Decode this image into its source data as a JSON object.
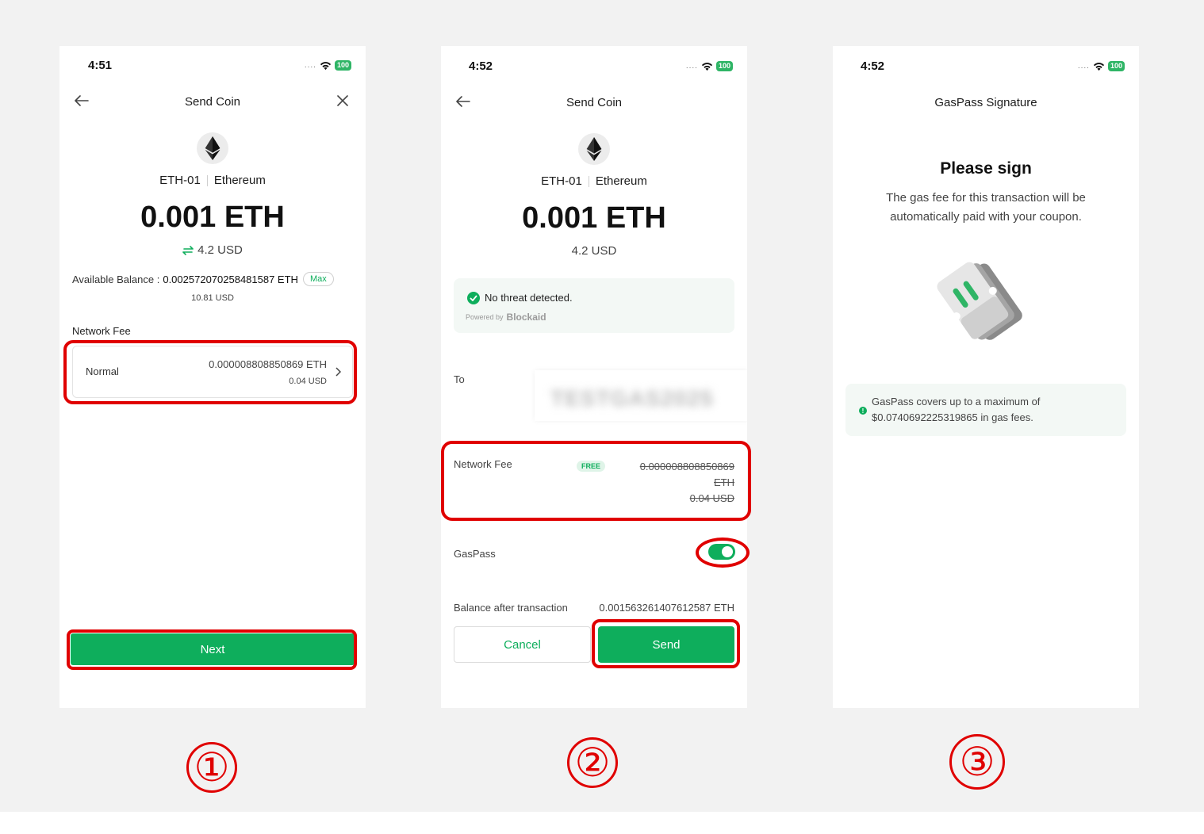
{
  "screen1": {
    "time": "4:51",
    "battery": "100",
    "title": "Send Coin",
    "coin_account": "ETH-01",
    "coin_name": "Ethereum",
    "amount": "0.001 ETH",
    "fiat": "4.2 USD",
    "balance_label": "Available Balance :",
    "balance_value": "0.002572070258481587 ETH",
    "max_label": "Max",
    "balance_fiat": "10.81 USD",
    "fee_section_label": "Network Fee",
    "fee_speed": "Normal",
    "fee_eth": "0.000008808850869 ETH",
    "fee_usd": "0.04 USD",
    "next_label": "Next"
  },
  "screen2": {
    "time": "4:52",
    "battery": "100",
    "title": "Send Coin",
    "coin_account": "ETH-01",
    "coin_name": "Ethereum",
    "amount": "0.001 ETH",
    "fiat": "4.2 USD",
    "threat_text": "No threat detected.",
    "powered_by": "Powered by",
    "powered_brand": "Blockaid",
    "to_label": "To",
    "to_value": "TESTGAS2025",
    "fee_label": "Network Fee",
    "free_badge": "FREE",
    "fee_eth_line1": "0.000008808850869",
    "fee_eth_line2": "ETH",
    "fee_usd": "0.04 USD",
    "gaspass_label": "GasPass",
    "gaspass_enabled": true,
    "balance_after_label": "Balance after transaction",
    "balance_after_value": "0.001563261407612587 ETH",
    "cancel_label": "Cancel",
    "send_label": "Send"
  },
  "screen3": {
    "time": "4:52",
    "battery": "100",
    "title": "GasPass Signature",
    "heading": "Please sign",
    "description_line1": "The gas fee for this transaction will be",
    "description_line2": "automatically paid with your coupon.",
    "info_line1": "GasPass covers up to a maximum of",
    "info_line2": "$0.0740692225319865 in gas fees."
  },
  "steps": [
    "①",
    "②",
    "③"
  ],
  "colors": {
    "accent_green": "#0eae5c",
    "highlight_red": "#e00000",
    "background": "#f2f2f2"
  }
}
